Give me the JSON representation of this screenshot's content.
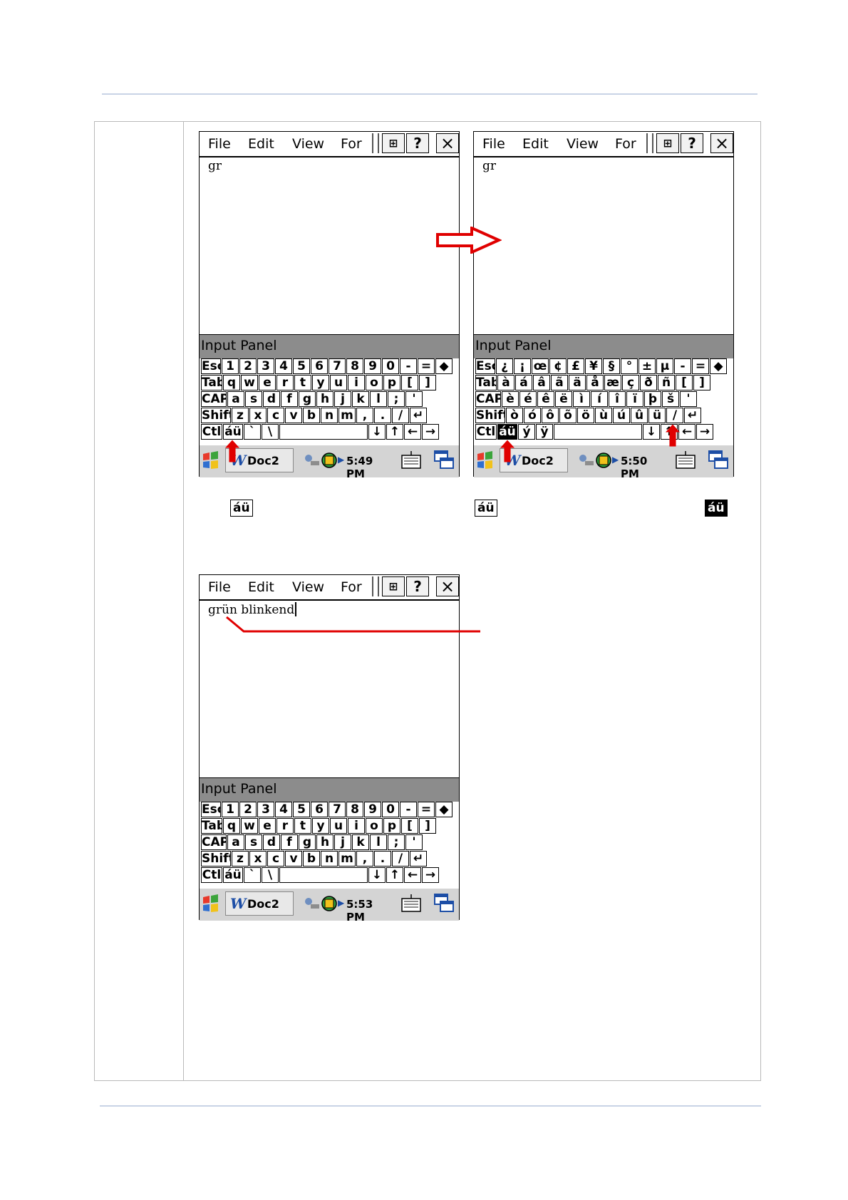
{
  "colors": {
    "accent_red": "#e00000",
    "rule": "#c9d3e6"
  },
  "menu": {
    "file": "File",
    "edit": "Edit",
    "view": "View",
    "format": "For",
    "help": "?",
    "close": "×"
  },
  "input_panel_label": "Input Panel",
  "screens": [
    {
      "doc_text": "gr",
      "time": "5:49 PM",
      "taskbar_doc": "Doc2",
      "keyboard_rows": [
        [
          "Esc",
          "1",
          "2",
          "3",
          "4",
          "5",
          "6",
          "7",
          "8",
          "9",
          "0",
          "-",
          "=",
          "◆"
        ],
        [
          "Tab",
          "q",
          "w",
          "e",
          "r",
          "t",
          "y",
          "u",
          "i",
          "o",
          "p",
          "[",
          "]"
        ],
        [
          "CAP",
          "a",
          "s",
          "d",
          "f",
          "g",
          "h",
          "j",
          "k",
          "l",
          ";",
          "'"
        ],
        [
          "Shift",
          "z",
          "x",
          "c",
          "v",
          "b",
          "n",
          "m",
          ",",
          ".",
          "/",
          "↵"
        ],
        [
          "Ctl",
          "áü",
          "`",
          "\\",
          "",
          "↓",
          "↑",
          "←",
          "→"
        ]
      ]
    },
    {
      "doc_text": "gr",
      "time": "5:50 PM",
      "taskbar_doc": "Doc2",
      "keyboard_rows": [
        [
          "Esc",
          "¿",
          "¡",
          "œ",
          "¢",
          "£",
          "¥",
          "§",
          "°",
          "±",
          "µ",
          "-",
          "=",
          "◆"
        ],
        [
          "Tab",
          "à",
          "á",
          "â",
          "ã",
          "ä",
          "å",
          "æ",
          "ç",
          "ð",
          "ñ",
          "[",
          "]"
        ],
        [
          "CAP",
          "è",
          "é",
          "ê",
          "ë",
          "ì",
          "í",
          "î",
          "ï",
          "þ",
          "š",
          "'"
        ],
        [
          "Shift",
          "ò",
          "ó",
          "ô",
          "õ",
          "ö",
          "ù",
          "ú",
          "û",
          "ü",
          "/",
          "↵"
        ],
        [
          "Ctl",
          "áü",
          "ý",
          "ÿ",
          "",
          "↓",
          "↑",
          "←",
          "→"
        ]
      ]
    },
    {
      "doc_text": "grün blinkend",
      "time": "5:53 PM",
      "taskbar_doc": "Doc2",
      "keyboard_rows": [
        [
          "Esc",
          "1",
          "2",
          "3",
          "4",
          "5",
          "6",
          "7",
          "8",
          "9",
          "0",
          "-",
          "=",
          "◆"
        ],
        [
          "Tab",
          "q",
          "w",
          "e",
          "r",
          "t",
          "y",
          "u",
          "i",
          "o",
          "p",
          "[",
          "]"
        ],
        [
          "CAP",
          "a",
          "s",
          "d",
          "f",
          "g",
          "h",
          "j",
          "k",
          "l",
          ";",
          "'"
        ],
        [
          "Shift",
          "z",
          "x",
          "c",
          "v",
          "b",
          "n",
          "m",
          ",",
          ".",
          "/",
          "↵"
        ],
        [
          "Ctl",
          "áü",
          "`",
          "\\",
          "",
          "↓",
          "↑",
          "←",
          "→"
        ]
      ]
    }
  ],
  "badges": {
    "left": "áü",
    "middle": "áü",
    "right": "áü"
  }
}
